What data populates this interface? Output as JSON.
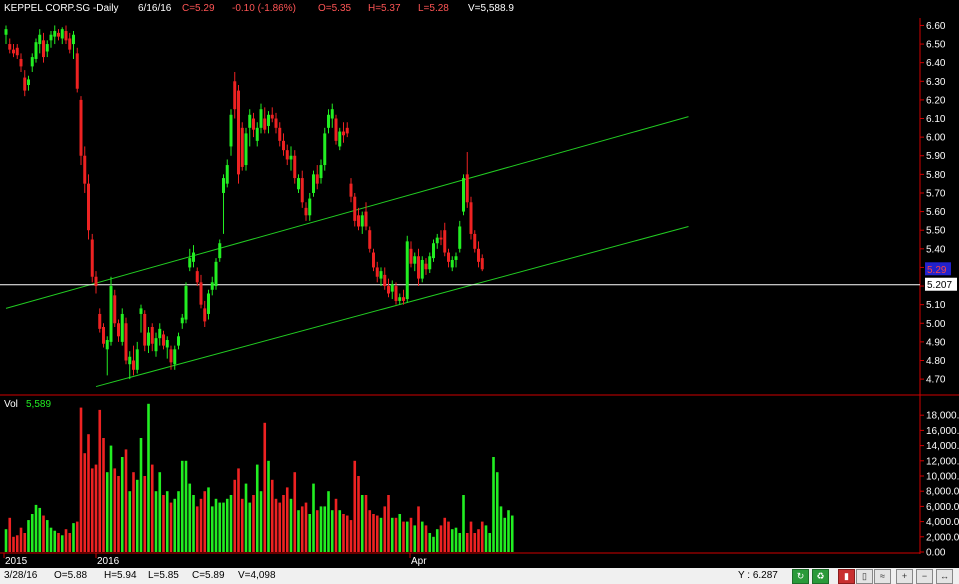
{
  "header": {
    "symbol": "KEPPEL CORP.SG -Daily",
    "date": "6/16/16",
    "close": "C=5.29",
    "change": "-0.10 (-1.86%)",
    "open": "O=5.35",
    "high": "H=5.37",
    "low": "L=5.28",
    "volume": "V=5,588.9"
  },
  "volume_panel": {
    "label": "Vol",
    "value": "5,589"
  },
  "price_tags": {
    "last": "5.29",
    "hline": "5.207"
  },
  "x_labels": [
    "2015",
    "2016",
    "Apr"
  ],
  "status_bar": {
    "date": "3/28/16",
    "open": "O=5.88",
    "high": "H=5.94",
    "low": "L=5.85",
    "close": "C=5.89",
    "volume": "V=4,098",
    "cursor_y": "Y : 6.287"
  },
  "colors": {
    "up": "#22ee22",
    "down": "#ee2222",
    "channel": "#22cc22",
    "hline": "#ffffff",
    "border": "#d00000"
  },
  "chart_data": [
    {
      "type": "candlestick",
      "title": "KEPPEL CORP.SG -Daily",
      "y_ticks": [
        "6.60",
        "6.50",
        "6.40",
        "6.30",
        "6.20",
        "6.10",
        "6.00",
        "5.90",
        "5.80",
        "5.70",
        "5.60",
        "5.50",
        "5.40",
        "5.30",
        "5.20",
        "5.10",
        "5.00",
        "4.90",
        "4.80",
        "4.70"
      ],
      "ylim": [
        4.62,
        6.64
      ],
      "horizontal_line": 5.207,
      "channel_lines": [
        {
          "from": {
            "bar": 0,
            "price": 5.08
          },
          "to": {
            "bar": 182,
            "price": 6.11
          }
        },
        {
          "from": {
            "bar": 24,
            "price": 4.66
          },
          "to": {
            "bar": 182,
            "price": 5.52
          }
        }
      ],
      "ohlc": [
        [
          6.55,
          6.6,
          6.5,
          6.58
        ],
        [
          6.5,
          6.53,
          6.45,
          6.47
        ],
        [
          6.47,
          6.5,
          6.43,
          6.45
        ],
        [
          6.48,
          6.5,
          6.42,
          6.44
        ],
        [
          6.42,
          6.45,
          6.35,
          6.38
        ],
        [
          6.32,
          6.36,
          6.22,
          6.25
        ],
        [
          6.28,
          6.33,
          6.25,
          6.31
        ],
        [
          6.38,
          6.45,
          6.35,
          6.43
        ],
        [
          6.42,
          6.53,
          6.4,
          6.51
        ],
        [
          6.5,
          6.58,
          6.45,
          6.55
        ],
        [
          6.52,
          6.56,
          6.4,
          6.43
        ],
        [
          6.46,
          6.52,
          6.43,
          6.5
        ],
        [
          6.52,
          6.57,
          6.48,
          6.55
        ],
        [
          6.54,
          6.6,
          6.5,
          6.57
        ],
        [
          6.56,
          6.58,
          6.52,
          6.54
        ],
        [
          6.53,
          6.59,
          6.5,
          6.58
        ],
        [
          6.57,
          6.6,
          6.5,
          6.52
        ],
        [
          6.53,
          6.56,
          6.45,
          6.47
        ],
        [
          6.5,
          6.57,
          6.42,
          6.55
        ],
        [
          6.45,
          6.48,
          6.24,
          6.26
        ],
        [
          6.2,
          6.22,
          5.85,
          5.9
        ],
        [
          5.9,
          5.95,
          5.7,
          5.75
        ],
        [
          5.75,
          5.8,
          5.45,
          5.5
        ],
        [
          5.45,
          5.48,
          5.22,
          5.25
        ],
        [
          5.25,
          5.28,
          5.16,
          5.2
        ],
        [
          5.05,
          5.08,
          4.95,
          4.97
        ],
        [
          4.98,
          5.0,
          4.87,
          4.89
        ],
        [
          4.86,
          4.93,
          4.72,
          4.91
        ],
        [
          4.9,
          5.25,
          4.88,
          5.2
        ],
        [
          5.15,
          5.18,
          4.98,
          5.0
        ],
        [
          5.0,
          5.02,
          4.9,
          4.93
        ],
        [
          4.9,
          5.08,
          4.88,
          5.05
        ],
        [
          5.0,
          5.03,
          4.78,
          4.8
        ],
        [
          4.78,
          4.85,
          4.7,
          4.82
        ],
        [
          4.8,
          4.88,
          4.72,
          4.75
        ],
        [
          4.75,
          4.9,
          4.73,
          4.86
        ],
        [
          5.05,
          5.1,
          4.95,
          5.08
        ],
        [
          5.05,
          5.07,
          4.85,
          4.88
        ],
        [
          4.88,
          4.98,
          4.84,
          4.95
        ],
        [
          4.98,
          5.0,
          4.85,
          4.89
        ],
        [
          4.85,
          4.95,
          4.82,
          4.92
        ],
        [
          4.92,
          5.0,
          4.88,
          4.97
        ],
        [
          4.94,
          4.96,
          4.86,
          4.88
        ],
        [
          4.87,
          4.93,
          4.81,
          4.91
        ],
        [
          4.86,
          4.88,
          4.75,
          4.79
        ],
        [
          4.78,
          4.88,
          4.75,
          4.86
        ],
        [
          4.88,
          4.95,
          4.86,
          4.93
        ],
        [
          5.0,
          5.05,
          4.97,
          5.03
        ],
        [
          5.02,
          5.22,
          5.0,
          5.2
        ],
        [
          5.3,
          5.4,
          5.28,
          5.35
        ],
        [
          5.33,
          5.42,
          5.3,
          5.38
        ],
        [
          5.28,
          5.3,
          5.2,
          5.22
        ],
        [
          5.22,
          5.26,
          5.08,
          5.1
        ],
        [
          5.08,
          5.12,
          4.98,
          5.01
        ],
        [
          5.05,
          5.18,
          5.02,
          5.16
        ],
        [
          5.18,
          5.25,
          5.15,
          5.22
        ],
        [
          5.2,
          5.35,
          5.18,
          5.33
        ],
        [
          5.35,
          5.45,
          5.33,
          5.43
        ],
        [
          5.7,
          5.8,
          5.48,
          5.78
        ],
        [
          5.75,
          5.88,
          5.73,
          5.85
        ],
        [
          5.95,
          6.15,
          5.9,
          6.12
        ],
        [
          6.3,
          6.35,
          6.1,
          6.15
        ],
        [
          6.25,
          6.28,
          5.75,
          5.8
        ],
        [
          6.05,
          6.08,
          5.82,
          5.84
        ],
        [
          5.85,
          6.05,
          5.82,
          6.02
        ],
        [
          6.05,
          6.15,
          5.95,
          6.12
        ],
        [
          6.1,
          6.13,
          6.0,
          6.04
        ],
        [
          5.98,
          6.08,
          5.95,
          6.05
        ],
        [
          6.05,
          6.18,
          6.02,
          6.15
        ],
        [
          6.1,
          6.16,
          6.02,
          6.04
        ],
        [
          6.06,
          6.14,
          6.02,
          6.12
        ],
        [
          6.12,
          6.16,
          6.08,
          6.1
        ],
        [
          6.1,
          6.13,
          6.02,
          6.05
        ],
        [
          6.05,
          6.08,
          5.95,
          5.98
        ],
        [
          5.98,
          6.02,
          5.9,
          5.93
        ],
        [
          5.93,
          5.96,
          5.85,
          5.88
        ],
        [
          5.88,
          5.95,
          5.82,
          5.9
        ],
        [
          5.9,
          5.93,
          5.75,
          5.78
        ],
        [
          5.72,
          5.8,
          5.7,
          5.78
        ],
        [
          5.78,
          5.82,
          5.62,
          5.65
        ],
        [
          5.62,
          5.65,
          5.55,
          5.58
        ],
        [
          5.58,
          5.7,
          5.55,
          5.67
        ],
        [
          5.7,
          5.82,
          5.68,
          5.8
        ],
        [
          5.8,
          5.85,
          5.72,
          5.75
        ],
        [
          5.78,
          5.88,
          5.75,
          5.85
        ],
        [
          5.85,
          6.05,
          5.82,
          6.02
        ],
        [
          6.05,
          6.15,
          6.02,
          6.12
        ],
        [
          6.1,
          6.18,
          6.05,
          6.15
        ],
        [
          6.1,
          6.12,
          5.96,
          5.98
        ],
        [
          5.95,
          6.05,
          5.93,
          6.03
        ],
        [
          6.03,
          6.08,
          5.97,
          6.01
        ],
        [
          6.05,
          6.08,
          6.0,
          6.02
        ],
        [
          5.75,
          5.78,
          5.65,
          5.68
        ],
        [
          5.68,
          5.7,
          5.52,
          5.55
        ],
        [
          5.58,
          5.62,
          5.5,
          5.52
        ],
        [
          5.52,
          5.6,
          5.48,
          5.58
        ],
        [
          5.6,
          5.65,
          5.5,
          5.52
        ],
        [
          5.5,
          5.52,
          5.38,
          5.4
        ],
        [
          5.38,
          5.4,
          5.28,
          5.3
        ],
        [
          5.3,
          5.33,
          5.22,
          5.25
        ],
        [
          5.24,
          5.3,
          5.2,
          5.28
        ],
        [
          5.26,
          5.3,
          5.18,
          5.2
        ],
        [
          5.2,
          5.24,
          5.14,
          5.16
        ],
        [
          5.17,
          5.23,
          5.13,
          5.21
        ],
        [
          5.2,
          5.22,
          5.1,
          5.12
        ],
        [
          5.12,
          5.16,
          5.1,
          5.14
        ],
        [
          5.14,
          5.18,
          5.1,
          5.12
        ],
        [
          5.13,
          5.47,
          5.11,
          5.44
        ],
        [
          5.4,
          5.44,
          5.3,
          5.32
        ],
        [
          5.32,
          5.38,
          5.28,
          5.36
        ],
        [
          5.36,
          5.4,
          5.2,
          5.24
        ],
        [
          5.24,
          5.36,
          5.22,
          5.34
        ],
        [
          5.32,
          5.35,
          5.26,
          5.29
        ],
        [
          5.29,
          5.38,
          5.27,
          5.36
        ],
        [
          5.35,
          5.45,
          5.33,
          5.43
        ],
        [
          5.43,
          5.48,
          5.4,
          5.46
        ],
        [
          5.46,
          5.5,
          5.42,
          5.45
        ],
        [
          5.5,
          5.54,
          5.36,
          5.38
        ],
        [
          5.38,
          5.4,
          5.3,
          5.33
        ],
        [
          5.3,
          5.36,
          5.28,
          5.34
        ],
        [
          5.34,
          5.38,
          5.3,
          5.36
        ],
        [
          5.4,
          5.55,
          5.38,
          5.52
        ],
        [
          5.6,
          5.8,
          5.58,
          5.78
        ],
        [
          5.8,
          5.92,
          5.62,
          5.65
        ],
        [
          5.65,
          5.68,
          5.45,
          5.48
        ],
        [
          5.48,
          5.5,
          5.38,
          5.4
        ],
        [
          5.4,
          5.44,
          5.3,
          5.33
        ],
        [
          5.35,
          5.37,
          5.28,
          5.29
        ]
      ],
      "volume": [
        3000,
        4500,
        2000,
        2200,
        3200,
        2500,
        4200,
        5000,
        6200,
        5800,
        4800,
        4200,
        3200,
        2800,
        2500,
        2200,
        3000,
        2500,
        3800,
        4000,
        19000,
        13000,
        15500,
        11000,
        11500,
        18700,
        15000,
        10500,
        14000,
        11000,
        10000,
        12500,
        13500,
        8000,
        10500,
        9500,
        15000,
        10000,
        19500,
        11500,
        8000,
        10500,
        7500,
        8000,
        6500,
        7000,
        8000,
        12000,
        12000,
        9000,
        7500,
        6000,
        7000,
        8000,
        8500,
        6000,
        7000,
        6500,
        6500,
        7000,
        7500,
        9500,
        11000,
        7000,
        9000,
        6500,
        7500,
        11500,
        8000,
        17000,
        12000,
        9500,
        7000,
        6500,
        7500,
        8500,
        7000,
        10500,
        5500,
        6000,
        6500,
        5000,
        9000,
        5500,
        6000,
        6000,
        8000,
        5500,
        7000,
        5500,
        5000,
        4800,
        4200,
        12000,
        10000,
        7500,
        7500,
        5500,
        5000,
        4800,
        4500,
        6000,
        7500,
        4500,
        4500,
        5000,
        4000,
        4000,
        4500,
        3500,
        6000,
        4000,
        3500,
        2500,
        2000,
        3000,
        3500,
        4500,
        4000,
        3000,
        3200,
        2500,
        7500,
        2500,
        4000,
        2500,
        3000,
        4000,
        3500,
        2500,
        12500,
        10500,
        6000,
        4500,
        5500,
        4800
      ]
    }
  ]
}
